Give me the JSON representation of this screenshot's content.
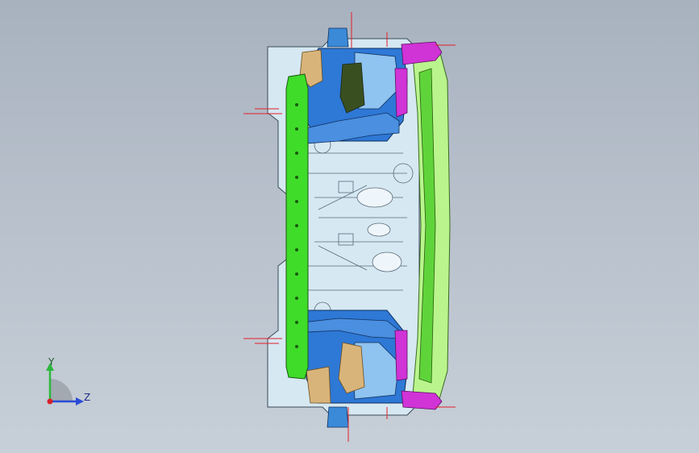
{
  "viewport": {
    "background_top": "#a8b2bf",
    "background_bottom": "#c7cfd8"
  },
  "model": {
    "colors": {
      "green_rail": "#3fdc2a",
      "blue_panel": "#2e78d6",
      "light_green": "#b9f58c",
      "magenta_bracket": "#d033d6",
      "tan_part": "#d9b47a",
      "dark_olive": "#3a4f20",
      "light_panel": "#d6e8f2",
      "red_guides": "#e0202a"
    }
  },
  "triad": {
    "y_label": "Y",
    "z_label": "Z",
    "y_color": "#2db83d",
    "z_color": "#2a4bd6",
    "x_color": "#d8202a"
  }
}
